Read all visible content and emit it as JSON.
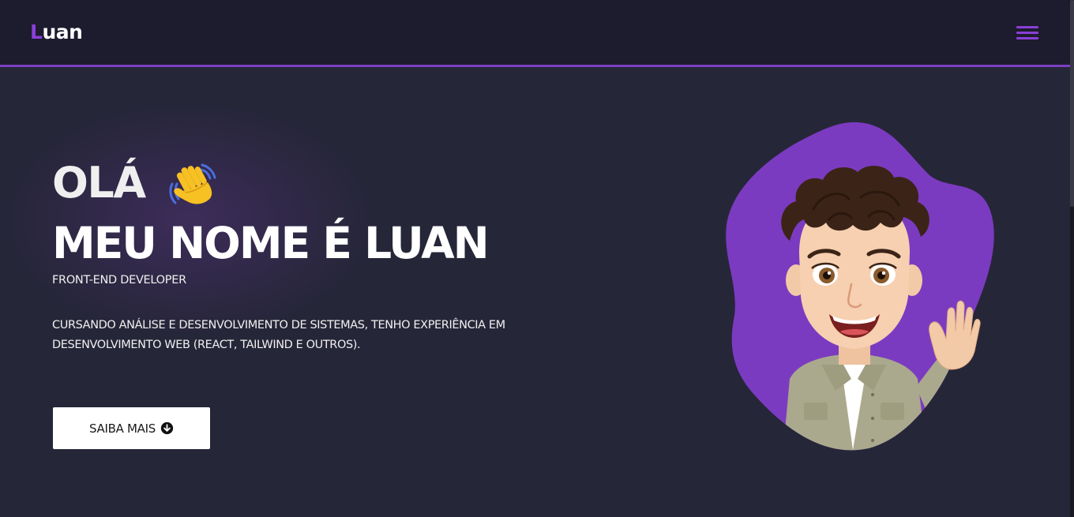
{
  "header": {
    "logo_accent": "L",
    "logo_rest": "uan"
  },
  "hero": {
    "greeting": "OLÁ",
    "title": "MEU NOME É LUAN",
    "role": "FRONT-END DEVELOPER",
    "description": "CURSANDO ANÁLISE E DESENVOLVIMENTO DE SISTEMAS, TENHO EXPERIÊNCIA EM DESENVOLVIMENTO WEB (REACT, TAILWIND E OUTROS).",
    "cta_label": "SAIBA MAIS"
  },
  "icons": {
    "menu": "hamburger-menu-icon",
    "wave": "waving-hand-icon",
    "cta": "arrow-circle-down-icon",
    "avatar": "avatar-illustration"
  },
  "colors": {
    "accent": "#8a3fd8",
    "background": "#262639",
    "header_bg": "#1d1b2e",
    "button_bg": "#ffffff"
  }
}
